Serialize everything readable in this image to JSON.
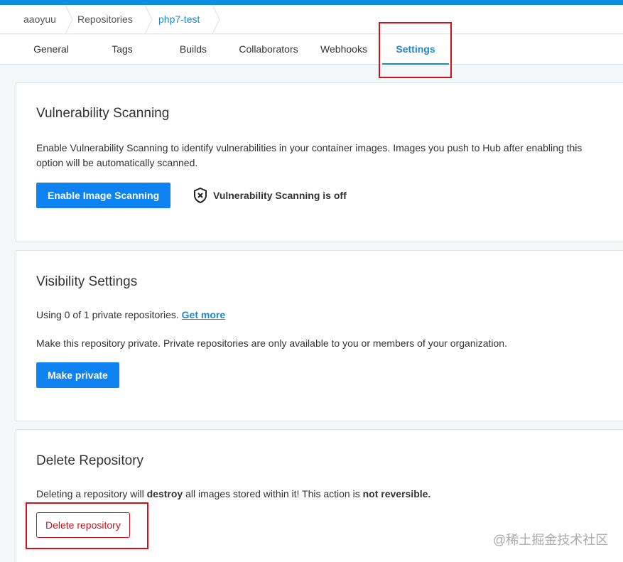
{
  "breadcrumb": {
    "items": [
      "aaoyuu",
      "Repositories",
      "php7-test"
    ]
  },
  "tabs": {
    "items": [
      "General",
      "Tags",
      "Builds",
      "Collaborators",
      "Webhooks",
      "Settings"
    ],
    "active": "Settings"
  },
  "vulnerability": {
    "title": "Vulnerability Scanning",
    "description": "Enable Vulnerability Scanning to identify vulnerabilities in your container images. Images you push to Hub after enabling this option will be automatically scanned.",
    "button": "Enable Image Scanning",
    "status": "Vulnerability Scanning is off",
    "status_icon": "shield-x-icon"
  },
  "visibility": {
    "title": "Visibility Settings",
    "usage": "Using 0 of 1 private repositories.",
    "usage_link": "Get more",
    "description": "Make this repository private. Private repositories are only available to you or members of your organization.",
    "button": "Make private"
  },
  "delete": {
    "title": "Delete Repository",
    "text_part1": "Deleting a repository will ",
    "text_bold1": "destroy",
    "text_part2": " all images stored within it! This action is ",
    "text_bold2": "not reversible.",
    "button": "Delete repository"
  },
  "watermark": "@稀土掘金技术社区",
  "colors": {
    "accent": "#1a89d4",
    "primary_button": "#0d82f0",
    "danger": "#d0111b",
    "highlight": "#d0111b"
  }
}
